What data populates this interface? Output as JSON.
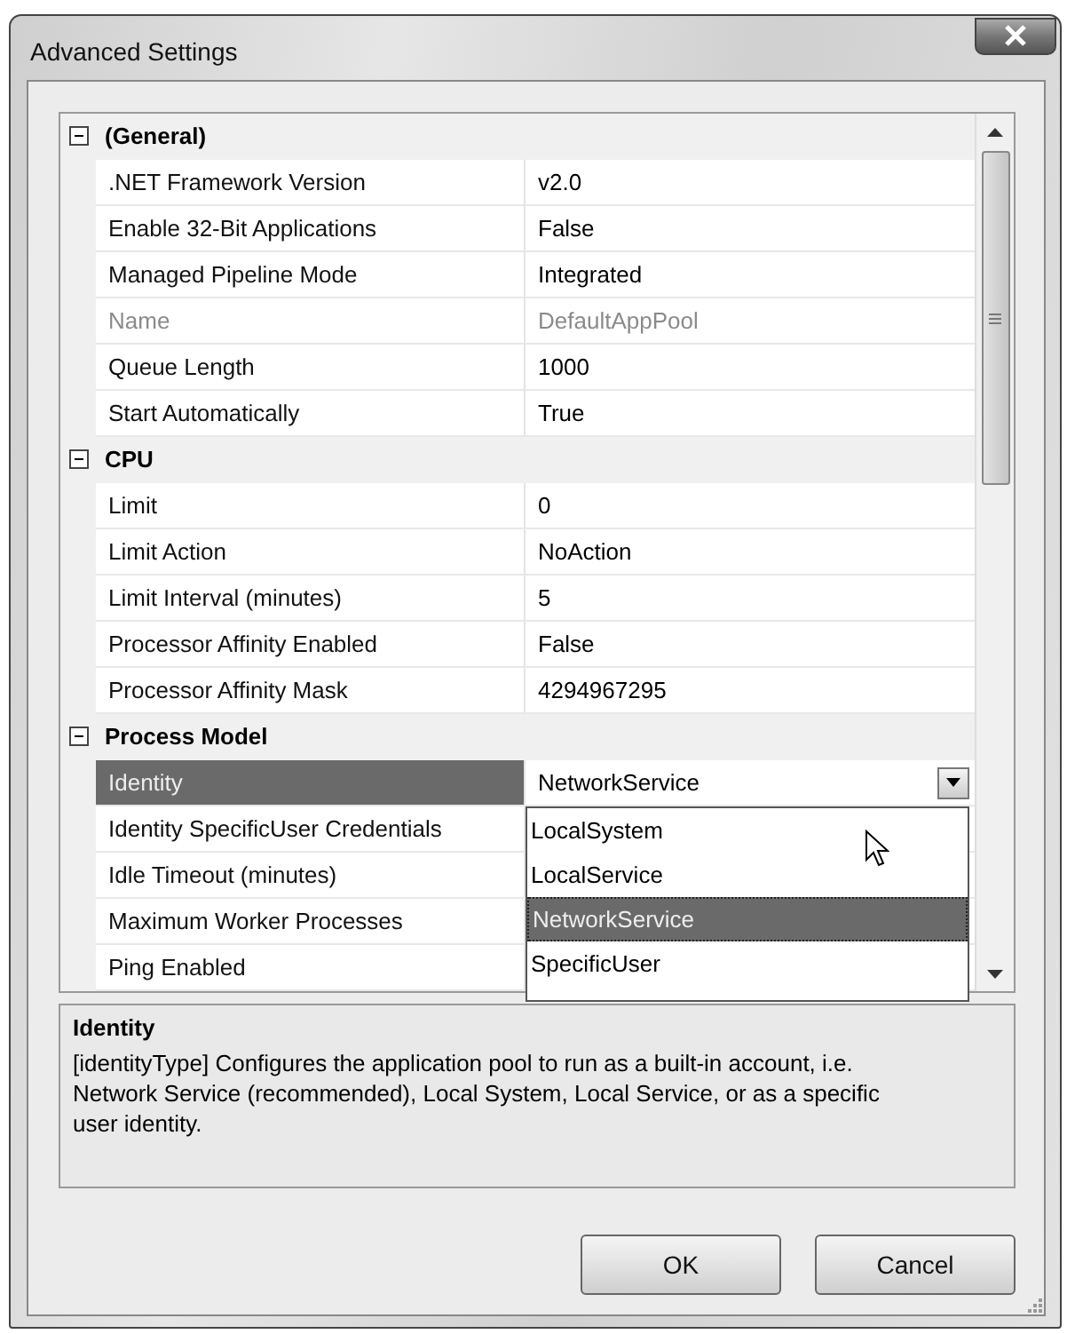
{
  "window": {
    "title": "Advanced Settings"
  },
  "property_grid": {
    "categories": [
      {
        "name": "(General)",
        "expanded": true,
        "properties": [
          {
            "name": ".NET Framework Version",
            "value": "v2.0",
            "disabled": false,
            "selected": false
          },
          {
            "name": "Enable 32-Bit Applications",
            "value": "False",
            "disabled": false,
            "selected": false
          },
          {
            "name": "Managed Pipeline Mode",
            "value": "Integrated",
            "disabled": false,
            "selected": false
          },
          {
            "name": "Name",
            "value": "DefaultAppPool",
            "disabled": true,
            "selected": false
          },
          {
            "name": "Queue Length",
            "value": "1000",
            "disabled": false,
            "selected": false
          },
          {
            "name": "Start Automatically",
            "value": "True",
            "disabled": false,
            "selected": false
          }
        ]
      },
      {
        "name": "CPU",
        "expanded": true,
        "properties": [
          {
            "name": "Limit",
            "value": "0",
            "disabled": false,
            "selected": false
          },
          {
            "name": "Limit Action",
            "value": "NoAction",
            "disabled": false,
            "selected": false
          },
          {
            "name": "Limit Interval (minutes)",
            "value": "5",
            "disabled": false,
            "selected": false
          },
          {
            "name": "Processor Affinity Enabled",
            "value": "False",
            "disabled": false,
            "selected": false
          },
          {
            "name": "Processor Affinity Mask",
            "value": "4294967295",
            "disabled": false,
            "selected": false
          }
        ]
      },
      {
        "name": "Process Model",
        "expanded": true,
        "properties": [
          {
            "name": "Identity",
            "value": "NetworkService",
            "disabled": false,
            "selected": true,
            "dropdown": [
              {
                "label": "LocalSystem",
                "selected": false
              },
              {
                "label": "LocalService",
                "selected": false
              },
              {
                "label": "NetworkService",
                "selected": true
              },
              {
                "label": "SpecificUser",
                "selected": false
              }
            ]
          },
          {
            "name": "Identity SpecificUser Credentials",
            "disabled": false,
            "selected": false
          },
          {
            "name": "Idle Timeout (minutes)",
            "disabled": false,
            "selected": false
          },
          {
            "name": "Maximum Worker Processes",
            "disabled": false,
            "selected": false
          },
          {
            "name": "Ping Enabled",
            "disabled": false,
            "selected": false
          }
        ]
      }
    ]
  },
  "description": {
    "title": "Identity",
    "text": "[identityType] Configures the application pool to run as a built-in account, i.e. Network Service (recommended), Local System, Local Service, or as a specific user identity."
  },
  "buttons": [
    {
      "label": "OK"
    },
    {
      "label": "Cancel"
    }
  ]
}
